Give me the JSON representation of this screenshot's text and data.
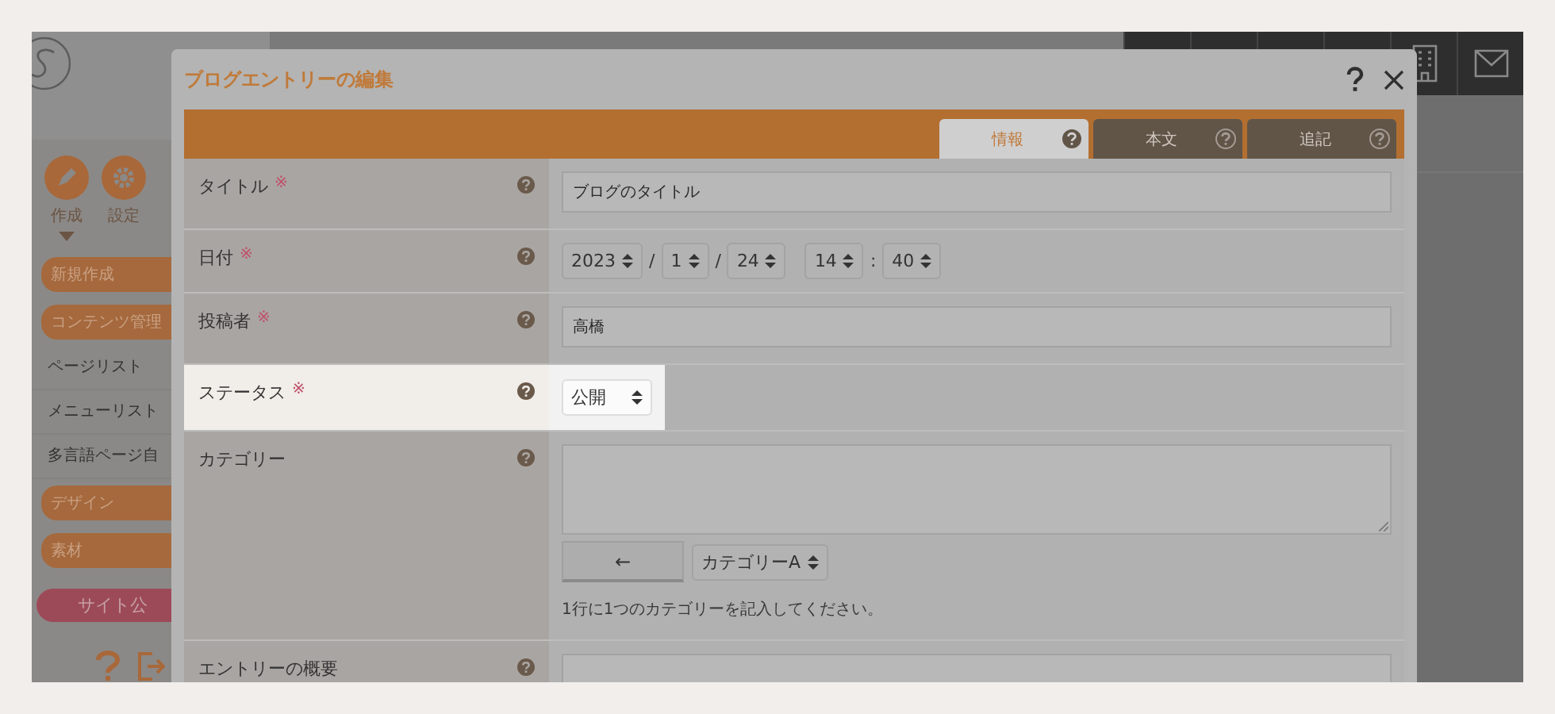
{
  "sidebar": {
    "nav": [
      {
        "label": "作成",
        "expanded": true,
        "kind": "pen"
      },
      {
        "label": "設定",
        "expanded": false,
        "kind": "gear"
      }
    ],
    "items": [
      {
        "kind": "pill",
        "label": "新規作成"
      },
      {
        "kind": "pill",
        "label": "コンテンツ管理"
      },
      {
        "kind": "link",
        "label": "ページリスト"
      },
      {
        "kind": "link",
        "label": "メニューリスト"
      },
      {
        "kind": "link",
        "label": "多言語ページ自"
      },
      {
        "kind": "pill",
        "label": "デザイン"
      },
      {
        "kind": "pill",
        "label": "素材"
      }
    ],
    "publish_button": "サイト公"
  },
  "dialog": {
    "title": "ブログエントリーの編集",
    "tabs": [
      {
        "label": "情報",
        "selected": true
      },
      {
        "label": "本文",
        "selected": false
      },
      {
        "label": "追記",
        "selected": false
      }
    ],
    "rows": [
      {
        "label": "タイトル",
        "required_mark": "※",
        "kind": "text",
        "value": "ブログのタイトル",
        "highlighted": false
      },
      {
        "label": "日付",
        "required_mark": "※",
        "kind": "date",
        "highlighted": false,
        "parts": [
          {
            "kind": "select",
            "value": "2023"
          },
          {
            "kind": "sep",
            "text": "/"
          },
          {
            "kind": "select",
            "value": "1"
          },
          {
            "kind": "sep",
            "text": "/"
          },
          {
            "kind": "select",
            "value": "24"
          },
          {
            "kind": "select",
            "value": "14",
            "spaced": true
          },
          {
            "kind": "sep",
            "text": ":"
          },
          {
            "kind": "select",
            "value": "40"
          }
        ]
      },
      {
        "label": "投稿者",
        "required_mark": "※",
        "kind": "text",
        "value": "高橋",
        "highlighted": false
      },
      {
        "label": "ステータス",
        "required_mark": "※",
        "kind": "select",
        "value": "公開",
        "highlighted": true
      },
      {
        "label": "カテゴリー",
        "kind": "category",
        "highlighted": false,
        "button": "←",
        "select": "カテゴリーA",
        "hint": "1行に1つのカテゴリーを記入してください。"
      },
      {
        "label": "エントリーの概要",
        "kind": "text",
        "highlighted": false
      }
    ]
  }
}
